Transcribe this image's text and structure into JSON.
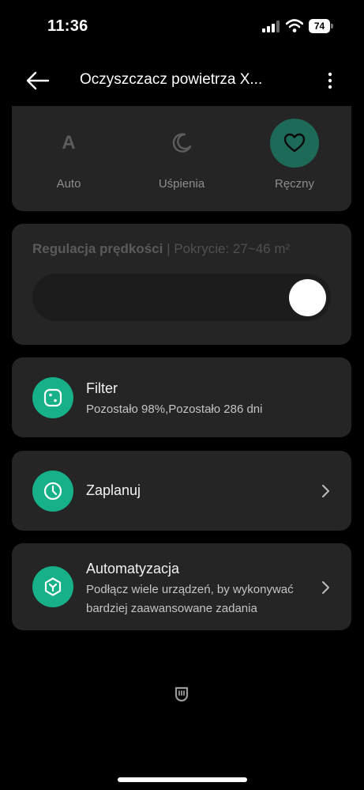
{
  "status": {
    "time": "11:36",
    "battery": "74"
  },
  "header": {
    "title": "Oczyszczacz powietrza X..."
  },
  "modes": [
    {
      "label": "Auto",
      "icon": "letter-a-icon",
      "glyph": "A",
      "active": false
    },
    {
      "label": "Uśpienia",
      "icon": "moon-icon",
      "active": false
    },
    {
      "label": "Ręczny",
      "icon": "heart-icon",
      "active": true
    }
  ],
  "speed": {
    "title": "Regulacja prędkości",
    "separator": "|",
    "coverage": "Pokrycie: 27~46 m²",
    "level": 1.0
  },
  "filter": {
    "title": "Filter",
    "subtitle": "Pozostało 98%,Pozostało 286 dni"
  },
  "schedule": {
    "title": "Zaplanuj"
  },
  "automation": {
    "title": "Automatyzacja",
    "subtitle_line1": "Podłącz wiele urządzeń, by wykonywać",
    "subtitle_line2": "bardziej zaawansowane zadania"
  },
  "colors": {
    "accent": "#16b188",
    "accent_dark": "#1e6a58",
    "card": "#252525",
    "background": "#000000"
  }
}
